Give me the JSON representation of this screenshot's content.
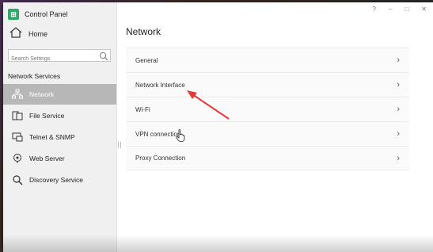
{
  "window": {
    "title": "Control Panel",
    "controls": [
      "?",
      "–",
      "□",
      "✕"
    ]
  },
  "sidebar": {
    "home_label": "Home",
    "search_placeholder": "Search Settings",
    "section_title": "Network Services",
    "items": [
      {
        "label": "Network",
        "icon": "network-icon",
        "active": true
      },
      {
        "label": "File Service",
        "icon": "file-service-icon"
      },
      {
        "label": "Telnet & SNMP",
        "icon": "telnet-icon"
      },
      {
        "label": "Web Server",
        "icon": "web-server-icon"
      },
      {
        "label": "Discovery Service",
        "icon": "discovery-icon"
      }
    ]
  },
  "main": {
    "title": "Network",
    "rows": [
      {
        "label": "General"
      },
      {
        "label": "Network Interface"
      },
      {
        "label": "Wi-Fi"
      },
      {
        "label": "VPN connection"
      },
      {
        "label": "Proxy Connection"
      }
    ]
  },
  "colors": {
    "accent": "#2fa86a",
    "active_bg": "#b7b7b7",
    "annotation_arrow": "#e53935"
  }
}
